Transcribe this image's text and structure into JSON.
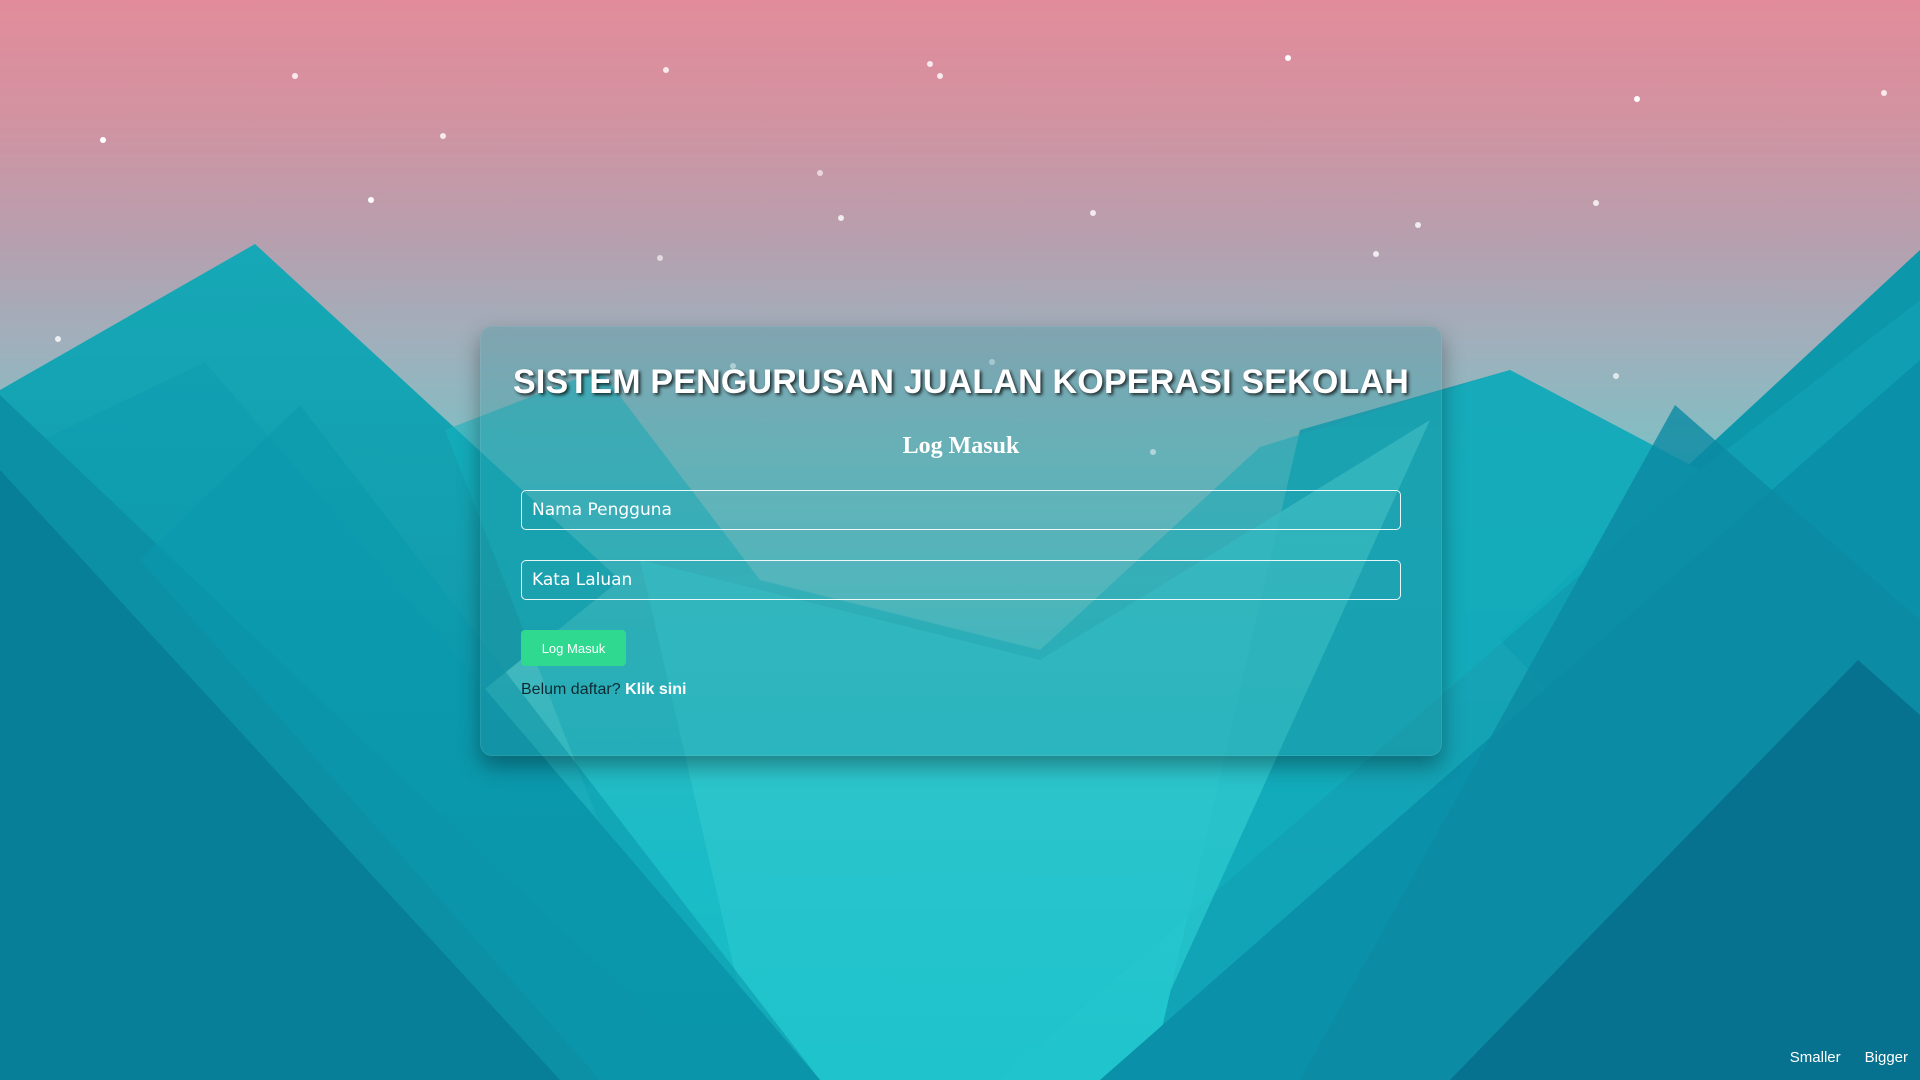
{
  "app": {
    "title": "SISTEM PENGURUSAN JUALAN KOPERASI SEKOLAH"
  },
  "login_form": {
    "heading": "Log Masuk",
    "username_placeholder": "Nama Pengguna",
    "password_placeholder": "Kata Laluan",
    "submit_label": "Log Masuk",
    "register_prompt": "Belum daftar?",
    "register_link": "Klik sini"
  },
  "font_controls": {
    "smaller_label": "Smaller",
    "bigger_label": "Bigger"
  },
  "colors": {
    "sky_top": "#e28c9b",
    "mountain_teal": "#0f9aab",
    "button_green": "#2fd98f"
  }
}
